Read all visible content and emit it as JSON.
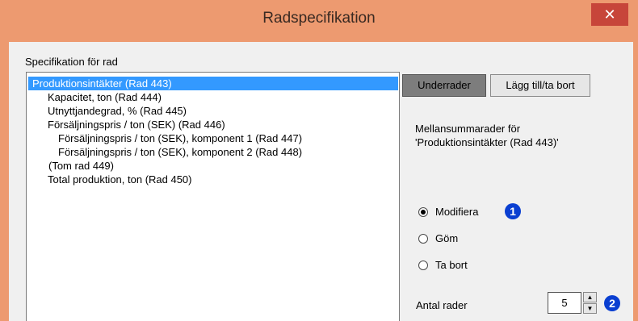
{
  "window": {
    "title": "Radspecifikation",
    "close_glyph": "✕"
  },
  "spec_label": "Specifikation för rad",
  "tree_items": [
    {
      "label": "Produktionsintäkter (Rad 443)"
    },
    {
      "label": "Kapacitet, ton (Rad 444)"
    },
    {
      "label": "Utnyttjandegrad, % (Rad 445)"
    },
    {
      "label": "Försäljningspris / ton (SEK) (Rad 446)"
    },
    {
      "label": "Försäljningspris / ton (SEK), komponent 1 (Rad 447)"
    },
    {
      "label": "Försäljningspris / ton (SEK), komponent 2 (Rad 448)"
    },
    {
      "label": "(Tom rad 449)"
    },
    {
      "label": "Total produktion, ton (Rad 450)"
    }
  ],
  "tabs": {
    "sub_rows": "Underrader",
    "add_remove": "Lägg till/ta bort"
  },
  "description": {
    "line1": "Mellansummarader för",
    "line2": "'Produktionsintäkter (Rad 443)'"
  },
  "options": [
    {
      "label": "Modifiera",
      "selected": true
    },
    {
      "label": "Göm",
      "selected": false
    },
    {
      "label": "Ta bort",
      "selected": false
    }
  ],
  "badges": [
    "1",
    "2"
  ],
  "row_count": {
    "label": "Antal rader",
    "value": "5"
  },
  "colors": {
    "title_bar": "#ed9a70",
    "selection": "#3399ff",
    "badge": "#0a3fd1"
  }
}
